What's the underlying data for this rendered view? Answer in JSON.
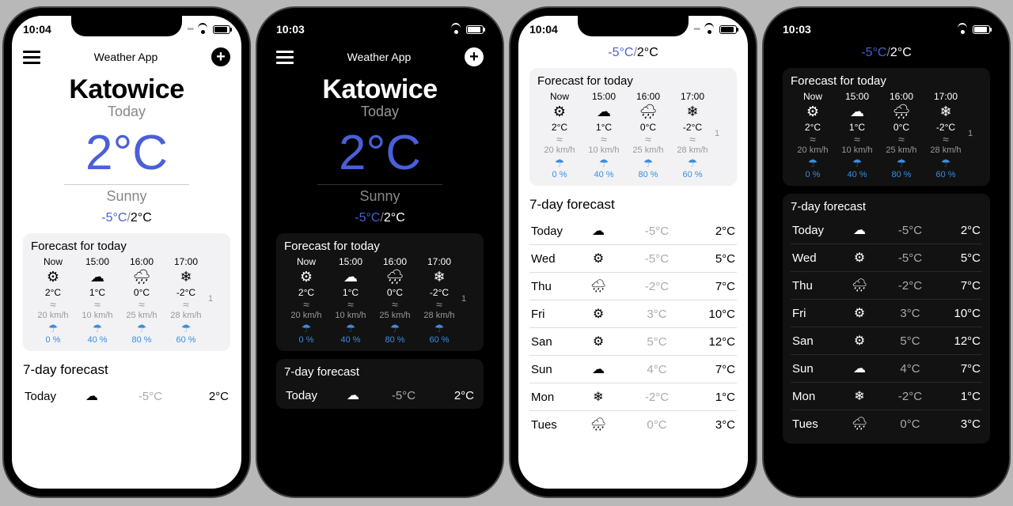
{
  "status": {
    "time1": "10:04",
    "time2": "10:03"
  },
  "app": {
    "title": "Weather App"
  },
  "hero": {
    "city": "Katowice",
    "today": "Today",
    "temp": "2°C",
    "condition": "Sunny",
    "lo": "-5°C",
    "hi": "2°C",
    "sep": "/"
  },
  "hourly": {
    "title": "Forecast for today",
    "cols": [
      {
        "time": "Now",
        "icon": "sun",
        "temp": "2°C",
        "wind": "20 km/h",
        "rain": "0 %"
      },
      {
        "time": "15:00",
        "icon": "cloud",
        "temp": "1°C",
        "wind": "10 km/h",
        "rain": "40 %"
      },
      {
        "time": "16:00",
        "icon": "rain",
        "temp": "0°C",
        "wind": "25 km/h",
        "rain": "80 %"
      },
      {
        "time": "17:00",
        "icon": "snow",
        "temp": "-2°C",
        "wind": "28 km/h",
        "rain": "60 %"
      }
    ],
    "peek": "1"
  },
  "daily": {
    "title": "7-day forecast",
    "rows": [
      {
        "day": "Today",
        "icon": "cloud",
        "lo": "-5°C",
        "hi": "2°C"
      },
      {
        "day": "Wed",
        "icon": "sun",
        "lo": "-5°C",
        "hi": "5°C"
      },
      {
        "day": "Thu",
        "icon": "rain",
        "lo": "-2°C",
        "hi": "7°C"
      },
      {
        "day": "Fri",
        "icon": "sun",
        "lo": "3°C",
        "hi": "10°C"
      },
      {
        "day": "San",
        "icon": "sun",
        "lo": "5°C",
        "hi": "12°C"
      },
      {
        "day": "Sun",
        "icon": "cloud",
        "lo": "4°C",
        "hi": "7°C"
      },
      {
        "day": "Mon",
        "icon": "snow",
        "lo": "-2°C",
        "hi": "1°C"
      },
      {
        "day": "Tues",
        "icon": "rain",
        "lo": "0°C",
        "hi": "3°C"
      }
    ]
  }
}
